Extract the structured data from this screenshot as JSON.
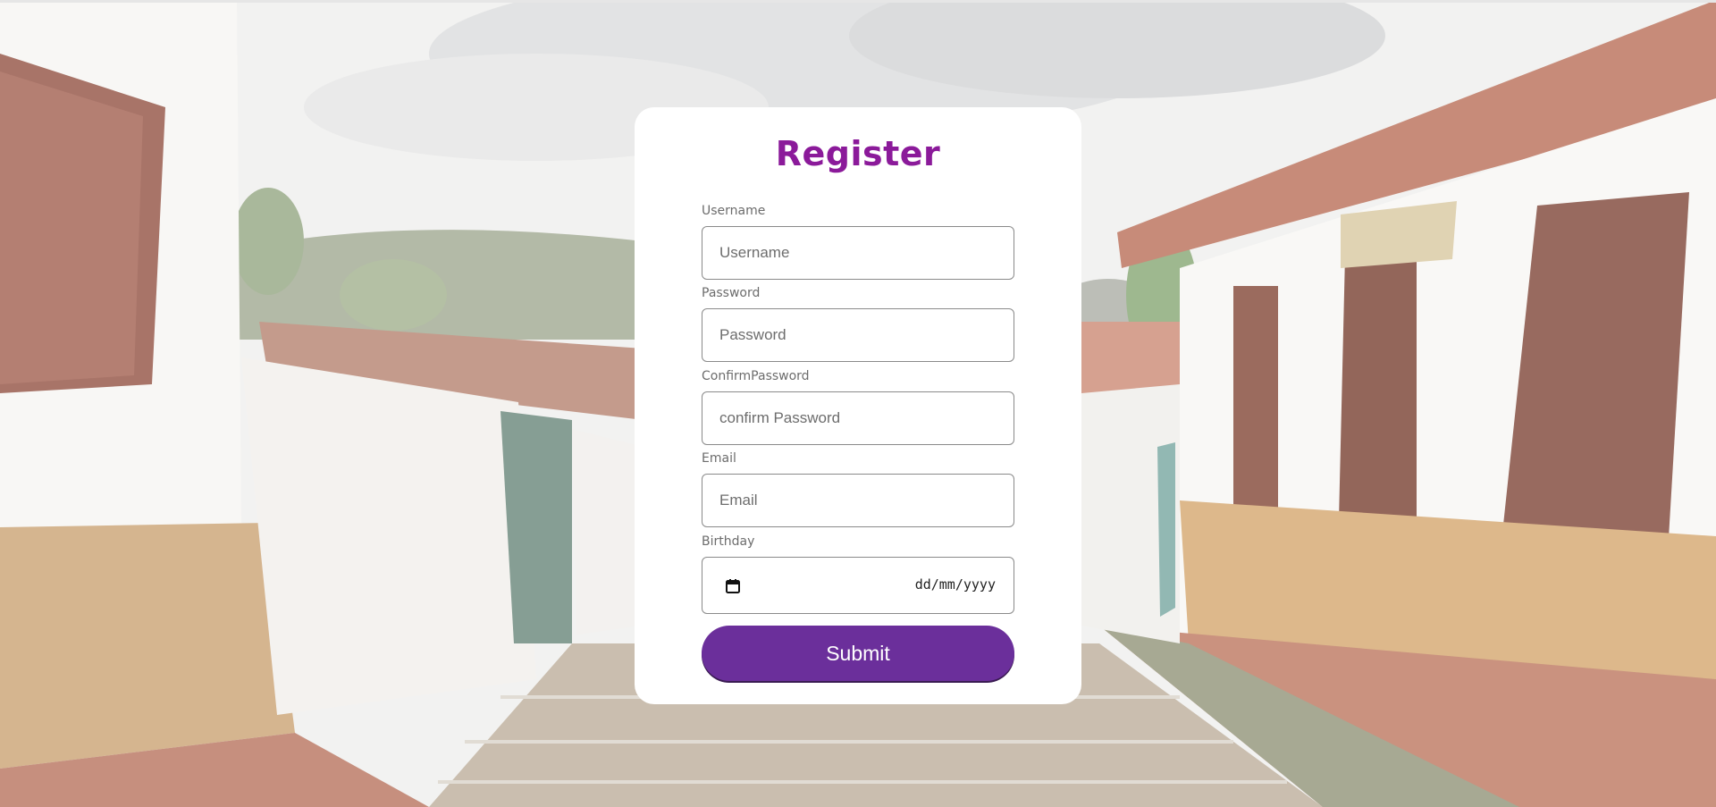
{
  "form": {
    "title": "Register",
    "fields": [
      {
        "label": "Username",
        "placeholder": "Username",
        "value": ""
      },
      {
        "label": "Password",
        "placeholder": "Password",
        "value": ""
      },
      {
        "label": "ConfirmPassword",
        "placeholder": "confirm Password",
        "value": ""
      },
      {
        "label": "Email",
        "placeholder": "Email",
        "value": ""
      }
    ],
    "birthday": {
      "label": "Birthday",
      "placeholder": "dd/mm/yyyy"
    },
    "submit_label": "Submit"
  },
  "colors": {
    "title": "#8b1a9a",
    "submit_bg": "#6b2f9b",
    "card_bg": "#ffffff"
  },
  "icons": {
    "birthday_icon": "calendar-icon"
  }
}
